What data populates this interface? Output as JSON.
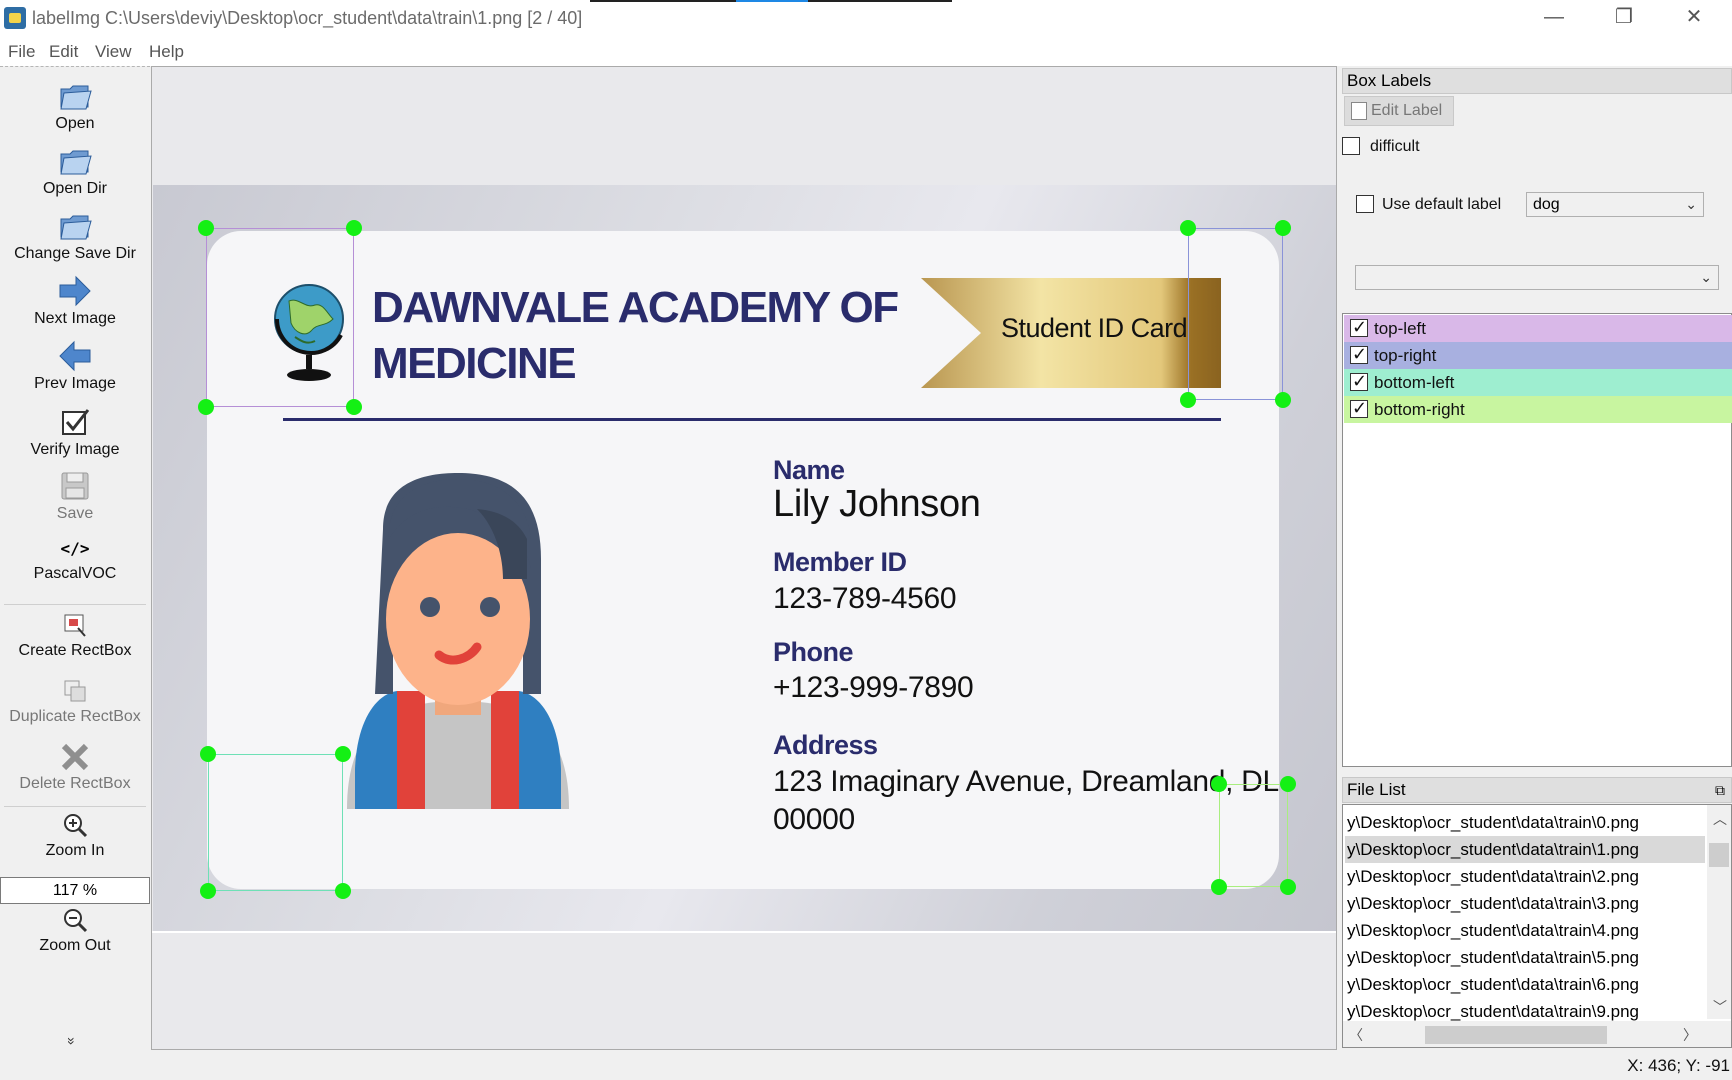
{
  "window": {
    "title": "labelImg C:\\Users\\deviy\\Desktop\\ocr_student\\data\\train\\1.png [2 / 40]",
    "minimize_glyph": "—",
    "restore_glyph": "❐",
    "close_glyph": "✕"
  },
  "menu": {
    "file": "File",
    "edit": "Edit",
    "view": "View",
    "help": "Help"
  },
  "toolbar": {
    "open": "Open",
    "open_dir": "Open Dir",
    "change_save_dir": "Change Save Dir",
    "next_image": "Next Image",
    "prev_image": "Prev Image",
    "verify_image": "Verify Image",
    "save": "Save",
    "format_icon_text": "</>",
    "format": "PascalVOC",
    "create_rectbox": "Create RectBox",
    "duplicate_rectbox": "Duplicate RectBox",
    "delete_rectbox": "Delete RectBox",
    "zoom_in": "Zoom In",
    "zoom_level": "117 %",
    "zoom_out": "Zoom Out",
    "more": "»"
  },
  "card": {
    "school_line1": "DAWNVALE ACADEMY OF",
    "school_line2": "MEDICINE",
    "badge": "Student ID Card",
    "name_label": "Name",
    "name_value": "Lily Johnson",
    "member_id_label": "Member ID",
    "member_id_value": "123-789-4560",
    "phone_label": "Phone",
    "phone_value": "+123-999-7890",
    "address_label": "Address",
    "address_line1": "123 Imaginary Avenue, Dreamland, DL",
    "address_line2": "00000"
  },
  "box_labels_panel": {
    "title": "Box Labels",
    "edit_label": "Edit Label",
    "difficult": "difficult",
    "use_default_label": "Use default label",
    "default_label_value": "dog",
    "labels": [
      {
        "text": "top-left",
        "checked": true,
        "color": "#d9b8e8"
      },
      {
        "text": "top-right",
        "checked": true,
        "color": "#a8b0e0"
      },
      {
        "text": "bottom-left",
        "checked": true,
        "color": "#9eeed0"
      },
      {
        "text": "bottom-right",
        "checked": true,
        "color": "#c8f5a0"
      }
    ]
  },
  "file_list_panel": {
    "title": "File List",
    "files": [
      "y\\Desktop\\ocr_student\\data\\train\\0.png",
      "y\\Desktop\\ocr_student\\data\\train\\1.png",
      "y\\Desktop\\ocr_student\\data\\train\\2.png",
      "y\\Desktop\\ocr_student\\data\\train\\3.png",
      "y\\Desktop\\ocr_student\\data\\train\\4.png",
      "y\\Desktop\\ocr_student\\data\\train\\5.png",
      "y\\Desktop\\ocr_student\\data\\train\\6.png",
      "y\\Desktop\\ocr_student\\data\\train\\9.png"
    ],
    "selected_index": 1
  },
  "status": {
    "coords": "X: 436; Y: -91"
  },
  "colors": {
    "handle": "#14f014",
    "top_left_box": "#b58fd6",
    "top_right_box": "#8a93d8",
    "bottom_left_box": "#6ee0b6",
    "bottom_right_box": "#a9ee7f",
    "navy_text": "#2a2c6c"
  }
}
